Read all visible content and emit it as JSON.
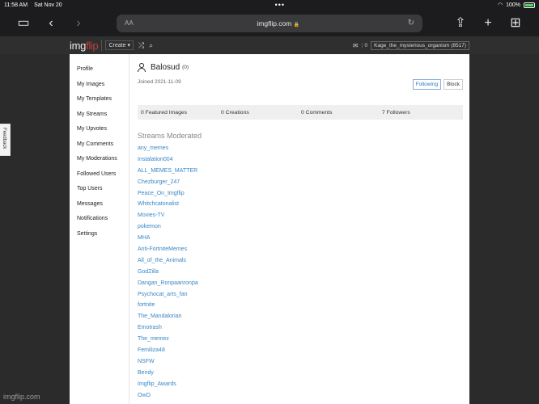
{
  "status_bar": {
    "time": "11:58 AM",
    "date": "Sat Nov 20",
    "dots": "•••",
    "battery_percent": "100%"
  },
  "browser": {
    "aa_label": "AA",
    "url": "imgflip.com",
    "lock_icon": "🔒"
  },
  "navbar": {
    "logo_main": "img",
    "logo_accent": "flip",
    "create_label": "Create ▾",
    "notif_count": "0",
    "user_label": "Kage_the_mysterious_organism (8517)"
  },
  "sidebar": {
    "items": [
      {
        "label": "Profile"
      },
      {
        "label": "My Images"
      },
      {
        "label": "My Templates"
      },
      {
        "label": "My Streams"
      },
      {
        "label": "My Upvotes"
      },
      {
        "label": "My Comments"
      },
      {
        "label": "My Moderations"
      },
      {
        "label": "Followed Users"
      },
      {
        "label": "Top Users"
      },
      {
        "label": "Messages"
      },
      {
        "label": "Notifications"
      },
      {
        "label": "Settings"
      }
    ]
  },
  "profile": {
    "username": "Balosud",
    "points": "(0)",
    "joined": "Joined 2021-11-09",
    "following_label": "Following",
    "block_label": "Block"
  },
  "stats": {
    "featured": "0 Featured Images",
    "creations": "0 Creations",
    "comments": "0 Comments",
    "followers": "7 Followers"
  },
  "streams": {
    "title": "Streams Moderated",
    "items": [
      "any_memes",
      "Instalation004",
      "ALL_MEMES_MATTER",
      "Chezburger_247",
      "Peace_On_Imgflip",
      "Whitchcatonalist",
      "Movies-TV",
      "pokemon",
      "MHA",
      "Anti-FortniteMemes",
      "All_of_the_Animals",
      "GodZilla",
      "Dangan_Ronpaanronpa",
      "Psychocat_arts_fan",
      "fortnite",
      "The_Mandalorian",
      "Emotrash",
      "The_memez",
      "Femiliza48",
      "NSFW",
      "Bendy",
      "Imgflip_Awards",
      "OwO"
    ]
  },
  "feedback_label": "Feedback",
  "watermark": "imgflip.com"
}
